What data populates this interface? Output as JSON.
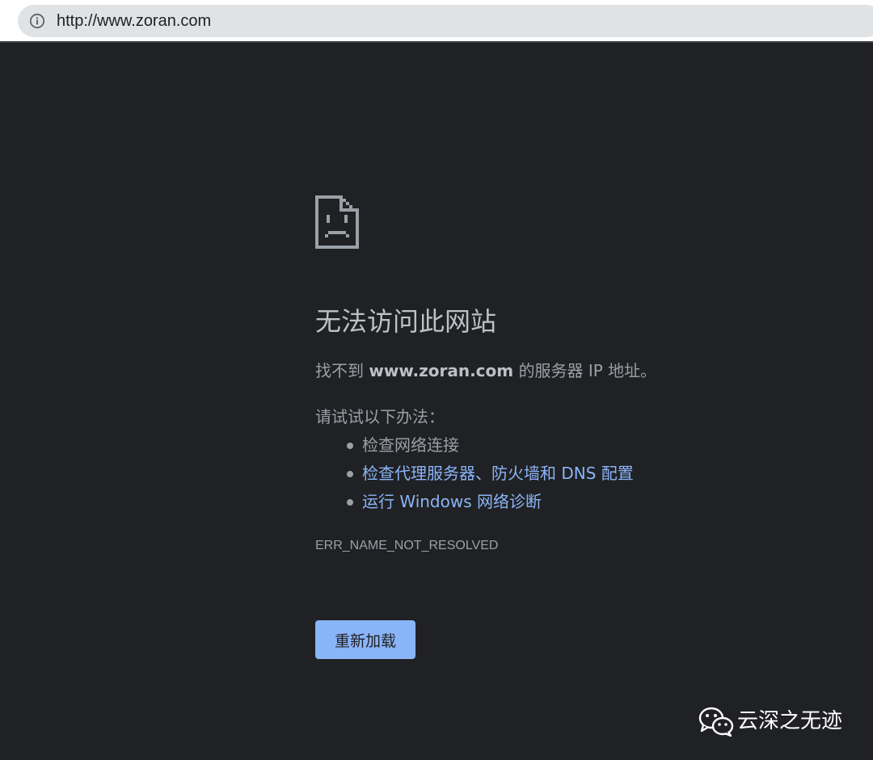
{
  "browser": {
    "url": "http://www.zoran.com",
    "info_icon": "info-circle-icon"
  },
  "error_page": {
    "icon": "sad-page-icon",
    "headline": "无法访问此网站",
    "desc_prefix": "找不到 ",
    "desc_domain": "www.zoran.com",
    "desc_suffix": " 的服务器 IP 地址。",
    "try_label": "请试试以下办法：",
    "suggestions": [
      {
        "label": "检查网络连接",
        "is_link": false
      },
      {
        "label": "检查代理服务器、防火墙和 DNS 配置",
        "is_link": true
      },
      {
        "label": "运行 Windows 网络诊断",
        "is_link": true
      }
    ],
    "error_code": "ERR_NAME_NOT_RESOLVED",
    "reload_label": "重新加载"
  },
  "watermark": {
    "icon": "wechat-icon",
    "text": "云深之无迹"
  },
  "colors": {
    "background": "#202124",
    "text": "#9aa0a6",
    "link": "#8ab4f8",
    "button": "#8ab4f8"
  }
}
